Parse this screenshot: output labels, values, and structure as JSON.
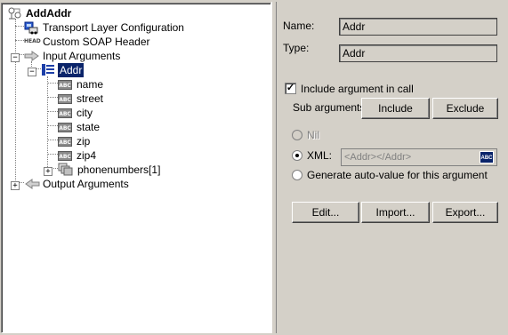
{
  "tree": {
    "root": {
      "label": "AddAddr",
      "icon": "method-icon"
    },
    "transport": {
      "label": "Transport Layer Configuration",
      "icon": "transport-icon"
    },
    "soap_header": {
      "label": "Custom SOAP Header",
      "icon": "soap-header-icon",
      "icon_text": "HEAD"
    },
    "input_args": {
      "label": "Input Arguments",
      "icon": "input-arrow-icon"
    },
    "addr": {
      "label": "Addr",
      "icon": "struct-icon"
    },
    "fields": [
      {
        "label": "name",
        "icon_text": "ABC"
      },
      {
        "label": "street",
        "icon_text": "ABC"
      },
      {
        "label": "city",
        "icon_text": "ABC"
      },
      {
        "label": "state",
        "icon_text": "ABC"
      },
      {
        "label": "zip",
        "icon_text": "ABC"
      },
      {
        "label": "zip4",
        "icon_text": "ABC"
      }
    ],
    "phonenumbers": {
      "label": "phonenumbers[1]",
      "icon": "array-icon"
    },
    "output_args": {
      "label": "Output Arguments",
      "icon": "output-arrow-icon"
    }
  },
  "props": {
    "name_label": "Name:",
    "name_value": "Addr",
    "type_label": "Type:",
    "type_value": "Addr",
    "include_label": "Include argument in call",
    "include_checked": true,
    "sub_args_label": "Sub arguments:",
    "include_btn": "Include",
    "exclude_btn": "Exclude",
    "nil_label": "Nil",
    "xml_label": "XML:",
    "xml_value": "<Addr></Addr>",
    "xml_btn_text": "ABC",
    "auto_label": "Generate auto-value for this argument",
    "selected_option": "XML",
    "edit_btn": "Edit...",
    "import_btn": "Import...",
    "export_btn": "Export..."
  }
}
